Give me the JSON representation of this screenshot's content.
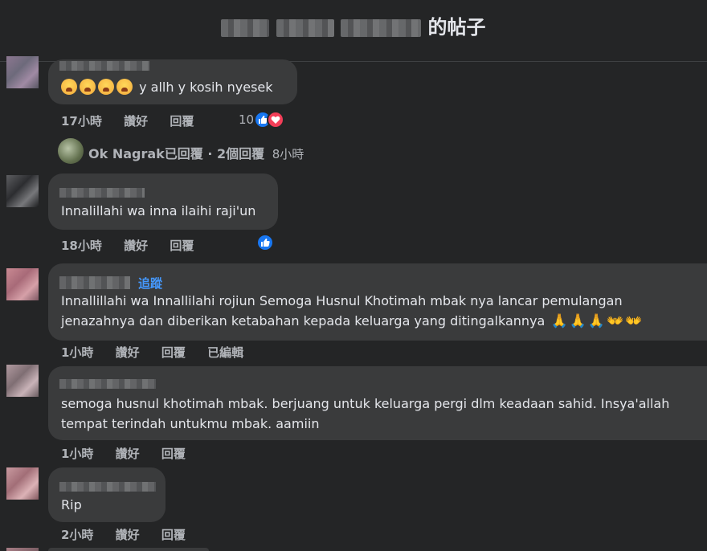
{
  "header": {
    "title_suffix": "的帖子"
  },
  "comments": [
    {
      "text": "y allh y kosih nyesek",
      "time": "17小時",
      "like": "讚好",
      "reply": "回覆",
      "reaction_count": "10"
    },
    {
      "text": "Innalillahi wa inna ilaihi raji'un",
      "time": "18小時",
      "like": "讚好",
      "reply": "回覆"
    },
    {
      "follow": "追蹤",
      "text": "Innallillahi wa Innallilahi rojiun Semoga Husnul Khotimah mbak nya lancar pemulangan jenazahnya dan diberikan ketabahan kepada keluarga yang ditingalkannya",
      "time": "1小時",
      "like": "讚好",
      "reply": "回覆",
      "edited": "已編輯"
    },
    {
      "text_line1": "semoga husnul khotimah mbak. berjuang untuk keluarga pergi dlm keadaan sahid. Insya'allah",
      "text_line2": "tempat terindah untukmu mbak. aamiin",
      "time": "1小時",
      "like": "讚好",
      "reply": "回覆"
    },
    {
      "text": "Rip",
      "time": "2小時",
      "like": "讚好",
      "reply": "回覆"
    }
  ],
  "reply_summary": {
    "name": "Ok Nagrak",
    "text": "已回覆 · 2個回覆",
    "time": "8小時"
  },
  "icons": [
    "like-icon",
    "love-icon",
    "cry-emoji",
    "pray-emoji",
    "clap-hands-emoji"
  ]
}
